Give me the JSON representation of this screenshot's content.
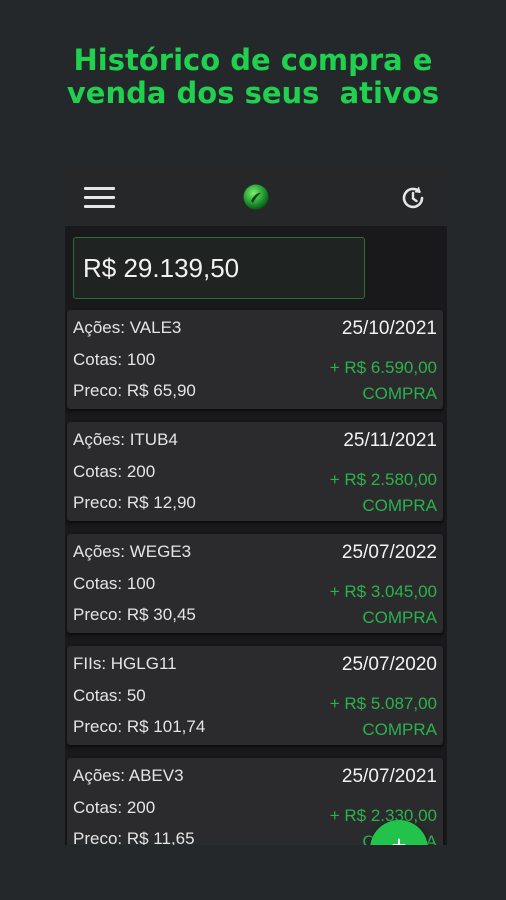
{
  "headline": {
    "line1": "Histórico de compra e",
    "line2": "venda dos seus  ativos"
  },
  "appbar": {
    "menu_icon": "hamburger-menu-icon",
    "logo_icon": "app-logo-icon",
    "history_icon": "history-icon"
  },
  "total": {
    "value": "R$ 29.139,50"
  },
  "transactions": [
    {
      "asset": "Ações: VALE3",
      "quotas": "Cotas: 100",
      "price": "Preco: R$ 65,90",
      "date": "25/10/2021",
      "amount": "+ R$ 6.590,00",
      "type": "COMPRA"
    },
    {
      "asset": "Ações: ITUB4",
      "quotas": "Cotas: 200",
      "price": "Preco: R$ 12,90",
      "date": "25/11/2021",
      "amount": "+ R$ 2.580,00",
      "type": "COMPRA"
    },
    {
      "asset": "Ações: WEGE3",
      "quotas": "Cotas: 100",
      "price": "Preco: R$ 30,45",
      "date": "25/07/2022",
      "amount": "+ R$ 3.045,00",
      "type": "COMPRA"
    },
    {
      "asset": "FIIs: HGLG11",
      "quotas": "Cotas: 50",
      "price": "Preco: R$ 101,74",
      "date": "25/07/2020",
      "amount": "+ R$ 5.087,00",
      "type": "COMPRA"
    },
    {
      "asset": "Ações: ABEV3",
      "quotas": "Cotas: 200",
      "price": "Preco: R$ 11,65",
      "date": "25/07/2021",
      "amount": "+ R$ 2.330,00",
      "type": "COMPRA"
    }
  ],
  "fab": {
    "label": "+",
    "icon": "add-icon"
  },
  "colors": {
    "accent": "#1fd14f",
    "background": "#25282a",
    "card": "#2b2b2d",
    "positive": "#2bb24c"
  }
}
